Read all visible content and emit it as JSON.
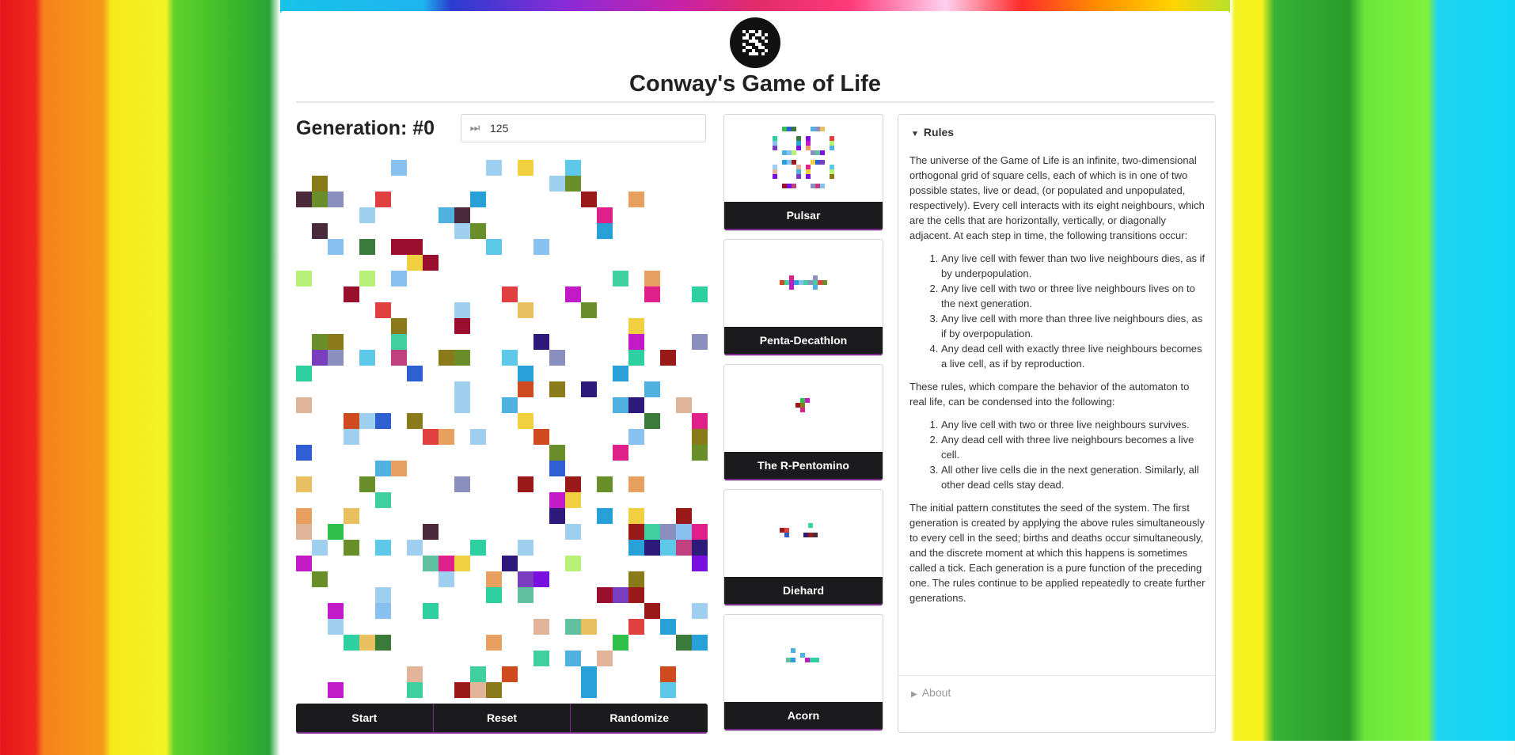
{
  "app": {
    "title": "Conway's Game of Life",
    "logo_icon": "glider-logo-icon"
  },
  "generation_label": "Generation: #0",
  "speed": {
    "icon": "fast-forward-icon",
    "value": "125"
  },
  "controls": {
    "start": "Start",
    "reset": "Reset",
    "randomize": "Randomize"
  },
  "presets": [
    {
      "name": "Pulsar"
    },
    {
      "name": "Penta-Decathlon"
    },
    {
      "name": "The R-Pentomino"
    },
    {
      "name": "Diehard"
    },
    {
      "name": "Acorn"
    }
  ],
  "rules": {
    "heading": "Rules",
    "intro": "The universe of the Game of Life is an infinite, two-dimensional orthogonal grid of square cells, each of which is in one of two possible states, live or dead, (or populated and unpopulated, respectively). Every cell interacts with its eight neighbours, which are the cells that are horizontally, vertically, or diagonally adjacent. At each step in time, the following transitions occur:",
    "list1": [
      "Any live cell with fewer than two live neighbours dies, as if by underpopulation.",
      "Any live cell with two or three live neighbours lives on to the next generation.",
      "Any live cell with more than three live neighbours dies, as if by overpopulation.",
      "Any dead cell with exactly three live neighbours becomes a live cell, as if by reproduction."
    ],
    "middle": "These rules, which compare the behavior of the automaton to real life, can be condensed into the following:",
    "list2": [
      "Any live cell with two or three live neighbours survives.",
      "Any dead cell with three live neighbours becomes a live cell.",
      "All other live cells die in the next generation. Similarly, all other dead cells stay dead."
    ],
    "outro": "The initial pattern constitutes the seed of the system. The first generation is created by applying the above rules simultaneously to every cell in the seed; births and deaths occur simultaneously, and the discrete moment at which this happens is sometimes called a tick. Each generation is a pure function of the preceding one. The rules continue to be applied repeatedly to create further generations."
  },
  "about": {
    "heading": "About"
  },
  "colors": {
    "panel_dark": "#1b1b1d",
    "accent_purple": "#7a2b8a",
    "cell_palette": [
      "#2e1a7a",
      "#2ecfa0",
      "#c21ac6",
      "#9b0f2e",
      "#8a7a1a",
      "#7b3dc0",
      "#2fbf4a",
      "#4a2a3a",
      "#8a8fc0",
      "#e0208a",
      "#2f5fd0",
      "#e2b59a",
      "#b8f07a",
      "#7a10e0",
      "#5dc8e8",
      "#9a1a1a",
      "#2aa0d8",
      "#9fd0f0",
      "#3a7a3a",
      "#e8a060",
      "#6a8f2a",
      "#c04080",
      "#60c0a0",
      "#f0d040",
      "#e04040",
      "#d04a20",
      "#88c0f0",
      "#40d0a0",
      "#50b0e0",
      "#e8c060"
    ]
  }
}
